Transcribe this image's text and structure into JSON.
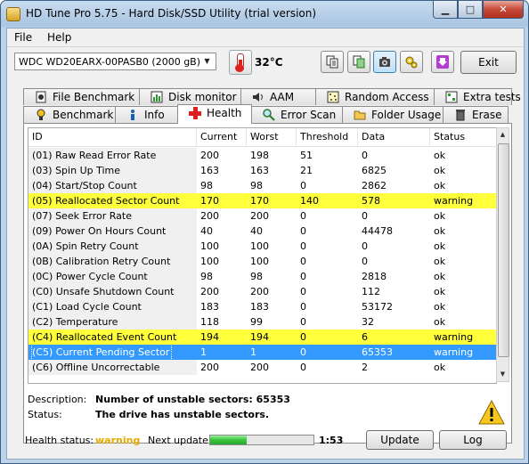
{
  "window": {
    "title": "HD Tune Pro 5.75 - Hard Disk/SSD Utility (trial version)"
  },
  "menu": {
    "file": "File",
    "help": "Help"
  },
  "toolbar": {
    "drive": "WDC WD20EARX-00PASB0 (2000 gB)",
    "temperature": "32°C",
    "exit_label": "Exit"
  },
  "tabs_top": [
    {
      "label": "File Benchmark",
      "icon": "file-benchmark-icon"
    },
    {
      "label": "Disk monitor",
      "icon": "disk-monitor-icon"
    },
    {
      "label": "AAM",
      "icon": "speaker-icon"
    },
    {
      "label": "Random Access",
      "icon": "random-access-icon"
    },
    {
      "label": "Extra tests",
      "icon": "extra-tests-icon"
    }
  ],
  "tabs_bottom": [
    {
      "label": "Benchmark",
      "icon": "benchmark-icon"
    },
    {
      "label": "Info",
      "icon": "info-icon"
    },
    {
      "label": "Health",
      "icon": "health-cross-icon"
    },
    {
      "label": "Error Scan",
      "icon": "magnifier-icon"
    },
    {
      "label": "Folder Usage",
      "icon": "folder-icon"
    },
    {
      "label": "Erase",
      "icon": "trash-icon"
    }
  ],
  "table": {
    "headers": [
      "ID",
      "Current",
      "Worst",
      "Threshold",
      "Data",
      "Status"
    ],
    "rows": [
      {
        "cells": [
          "(01) Raw Read Error Rate",
          "200",
          "198",
          "51",
          "0",
          "ok"
        ],
        "state": ""
      },
      {
        "cells": [
          "(03) Spin Up Time",
          "163",
          "163",
          "21",
          "6825",
          "ok"
        ],
        "state": ""
      },
      {
        "cells": [
          "(04) Start/Stop Count",
          "98",
          "98",
          "0",
          "2862",
          "ok"
        ],
        "state": ""
      },
      {
        "cells": [
          "(05) Reallocated Sector Count",
          "170",
          "170",
          "140",
          "578",
          "warning"
        ],
        "state": "warn"
      },
      {
        "cells": [
          "(07) Seek Error Rate",
          "200",
          "200",
          "0",
          "0",
          "ok"
        ],
        "state": ""
      },
      {
        "cells": [
          "(09) Power On Hours Count",
          "40",
          "40",
          "0",
          "44478",
          "ok"
        ],
        "state": ""
      },
      {
        "cells": [
          "(0A) Spin Retry Count",
          "100",
          "100",
          "0",
          "0",
          "ok"
        ],
        "state": ""
      },
      {
        "cells": [
          "(0B) Calibration Retry Count",
          "100",
          "100",
          "0",
          "0",
          "ok"
        ],
        "state": ""
      },
      {
        "cells": [
          "(0C) Power Cycle Count",
          "98",
          "98",
          "0",
          "2818",
          "ok"
        ],
        "state": ""
      },
      {
        "cells": [
          "(C0) Unsafe Shutdown Count",
          "200",
          "200",
          "0",
          "112",
          "ok"
        ],
        "state": ""
      },
      {
        "cells": [
          "(C1) Load Cycle Count",
          "183",
          "183",
          "0",
          "53172",
          "ok"
        ],
        "state": ""
      },
      {
        "cells": [
          "(C2) Temperature",
          "118",
          "99",
          "0",
          "32",
          "ok"
        ],
        "state": ""
      },
      {
        "cells": [
          "(C4) Reallocated Event Count",
          "194",
          "194",
          "0",
          "6",
          "warning"
        ],
        "state": "warn"
      },
      {
        "cells": [
          "(C5) Current Pending Sector",
          "1",
          "1",
          "0",
          "65353",
          "warning"
        ],
        "state": "sel"
      },
      {
        "cells": [
          "(C6) Offline Uncorrectable",
          "200",
          "200",
          "0",
          "2",
          "ok"
        ],
        "state": ""
      }
    ]
  },
  "details": {
    "description_label": "Description:",
    "description": "Number of unstable sectors: 65353",
    "status_label": "Status:",
    "status": "The drive has unstable sectors."
  },
  "statusbar": {
    "health_label": "Health status:",
    "health_value": "warning",
    "next_update_label": "Next update:",
    "progress_fraction": 0.35,
    "countdown": "1:53",
    "update_label": "Update",
    "log_label": "Log"
  },
  "colors": {
    "warning_row": "#ffff3c",
    "selected_row": "#3399ff",
    "health_warning": "#e5a800"
  }
}
